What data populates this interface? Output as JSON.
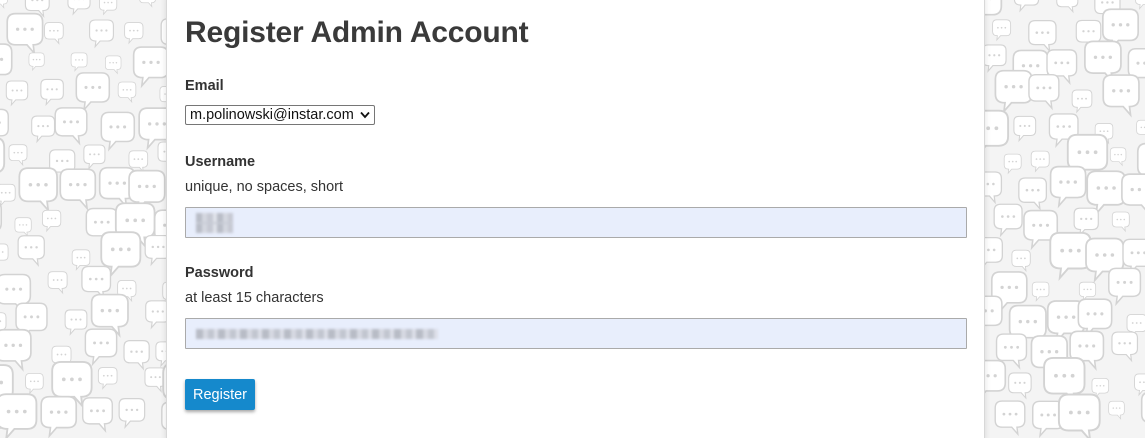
{
  "page": {
    "title": "Register Admin Account"
  },
  "form": {
    "email": {
      "label": "Email",
      "selected_value": "m.polinowski@instar.com"
    },
    "username": {
      "label": "Username",
      "hint": "unique, no spaces, short",
      "value_state": "redacted"
    },
    "password": {
      "label": "Password",
      "hint": "at least 15 characters",
      "value_state": "redacted"
    },
    "submit_label": "Register"
  },
  "colors": {
    "panel_background": "#ffffff",
    "page_background": "#f4f4f4",
    "autofill_field": "#e8eefc",
    "button_primary": "#1589cc",
    "button_text": "#ffffff",
    "heading_text": "#3a3a3a"
  },
  "icons": {
    "select_arrow": "chevron-down-icon",
    "background": "speech-bubble-pattern"
  }
}
